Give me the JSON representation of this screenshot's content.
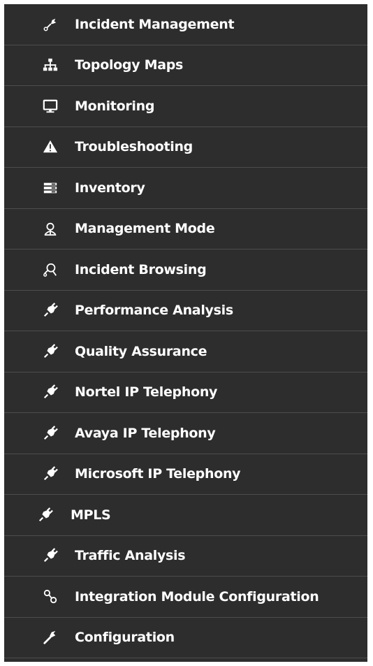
{
  "nav": {
    "items": [
      {
        "label": "Incident Management",
        "icon": "plug-wrench-icon"
      },
      {
        "label": "Topology Maps",
        "icon": "sitemap-icon"
      },
      {
        "label": "Monitoring",
        "icon": "monitor-icon"
      },
      {
        "label": "Troubleshooting",
        "icon": "warning-icon"
      },
      {
        "label": "Inventory",
        "icon": "list-icon"
      },
      {
        "label": "Management Mode",
        "icon": "user-headset-icon"
      },
      {
        "label": "Incident Browsing",
        "icon": "browse-icon"
      },
      {
        "label": "Performance Analysis",
        "icon": "plug-icon"
      },
      {
        "label": "Quality Assurance",
        "icon": "plug-icon"
      },
      {
        "label": "Nortel IP Telephony",
        "icon": "plug-icon"
      },
      {
        "label": "Avaya IP Telephony",
        "icon": "plug-icon"
      },
      {
        "label": "Microsoft IP Telephony",
        "icon": "plug-icon"
      },
      {
        "label": "MPLS",
        "icon": "plug-icon"
      },
      {
        "label": "Traffic Analysis",
        "icon": "plug-icon"
      },
      {
        "label": "Integration Module Configuration",
        "icon": "link-icon"
      },
      {
        "label": "Configuration",
        "icon": "wrench-icon"
      }
    ]
  },
  "colors": {
    "panel_background": "#2d2d2d",
    "divider": "#4d4d4d",
    "text": "#ffffff"
  }
}
